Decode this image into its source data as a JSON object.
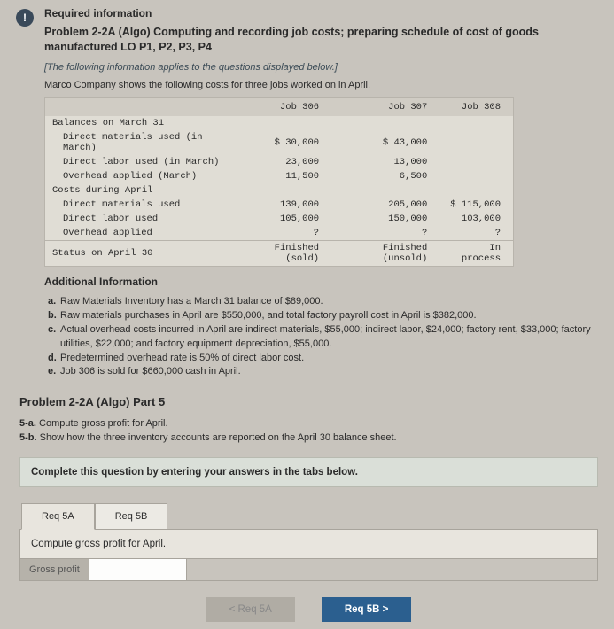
{
  "header": {
    "required": "Required information",
    "title": "Problem 2-2A (Algo) Computing and recording job costs; preparing schedule of cost of goods manufactured LO P1, P2, P3, P4",
    "note": "[The following information applies to the questions displayed below.]",
    "intro": "Marco Company shows the following costs for three jobs worked on in April."
  },
  "table": {
    "cols": [
      "",
      "Job 306",
      "Job 307",
      "Job 308"
    ],
    "rows": [
      {
        "label": "Balances on March 31",
        "vals": [
          "",
          "",
          ""
        ]
      },
      {
        "label": "Direct materials used (in March)",
        "indent": true,
        "vals": [
          "$ 30,000",
          "$ 43,000",
          ""
        ]
      },
      {
        "label": "Direct labor used (in March)",
        "indent": true,
        "vals": [
          "23,000",
          "13,000",
          ""
        ]
      },
      {
        "label": "Overhead applied (March)",
        "indent": true,
        "vals": [
          "11,500",
          "6,500",
          ""
        ]
      },
      {
        "label": "Costs during April",
        "vals": [
          "",
          "",
          ""
        ]
      },
      {
        "label": "Direct materials used",
        "indent": true,
        "vals": [
          "139,000",
          "205,000",
          "$ 115,000"
        ]
      },
      {
        "label": "Direct labor used",
        "indent": true,
        "vals": [
          "105,000",
          "150,000",
          "103,000"
        ]
      },
      {
        "label": "Overhead applied",
        "indent": true,
        "vals": [
          "?",
          "?",
          "?"
        ]
      },
      {
        "label": "Status on April 30",
        "sep": true,
        "vals": [
          "Finished (sold)",
          "Finished (unsold)",
          "In process"
        ]
      }
    ]
  },
  "additional": {
    "heading": "Additional Information",
    "items": [
      {
        "k": "a.",
        "t": "Raw Materials Inventory has a March 31 balance of $89,000."
      },
      {
        "k": "b.",
        "t": "Raw materials purchases in April are $550,000, and total factory payroll cost in April is $382,000."
      },
      {
        "k": "c.",
        "t": "Actual overhead costs incurred in April are indirect materials, $55,000; indirect labor, $24,000; factory rent, $33,000; factory utilities, $22,000; and factory equipment depreciation, $55,000."
      },
      {
        "k": "d.",
        "t": "Predetermined overhead rate is 50% of direct labor cost."
      },
      {
        "k": "e.",
        "t": "Job 306 is sold for $660,000 cash in April."
      }
    ]
  },
  "part5": {
    "title": "Problem 2-2A (Algo) Part 5",
    "a": {
      "k": "5-a.",
      "t": " Compute gross profit for April."
    },
    "b": {
      "k": "5-b.",
      "t": " Show how the three inventory accounts are reported on the April 30 balance sheet."
    }
  },
  "complete": "Complete this question by entering your answers in the tabs below.",
  "tabs": {
    "a": "Req 5A",
    "b": "Req 5B",
    "instruction": "Compute gross profit for April.",
    "gp_label": "Gross profit"
  },
  "nav": {
    "prev": "< Req 5A",
    "next": "Req 5B  >"
  }
}
